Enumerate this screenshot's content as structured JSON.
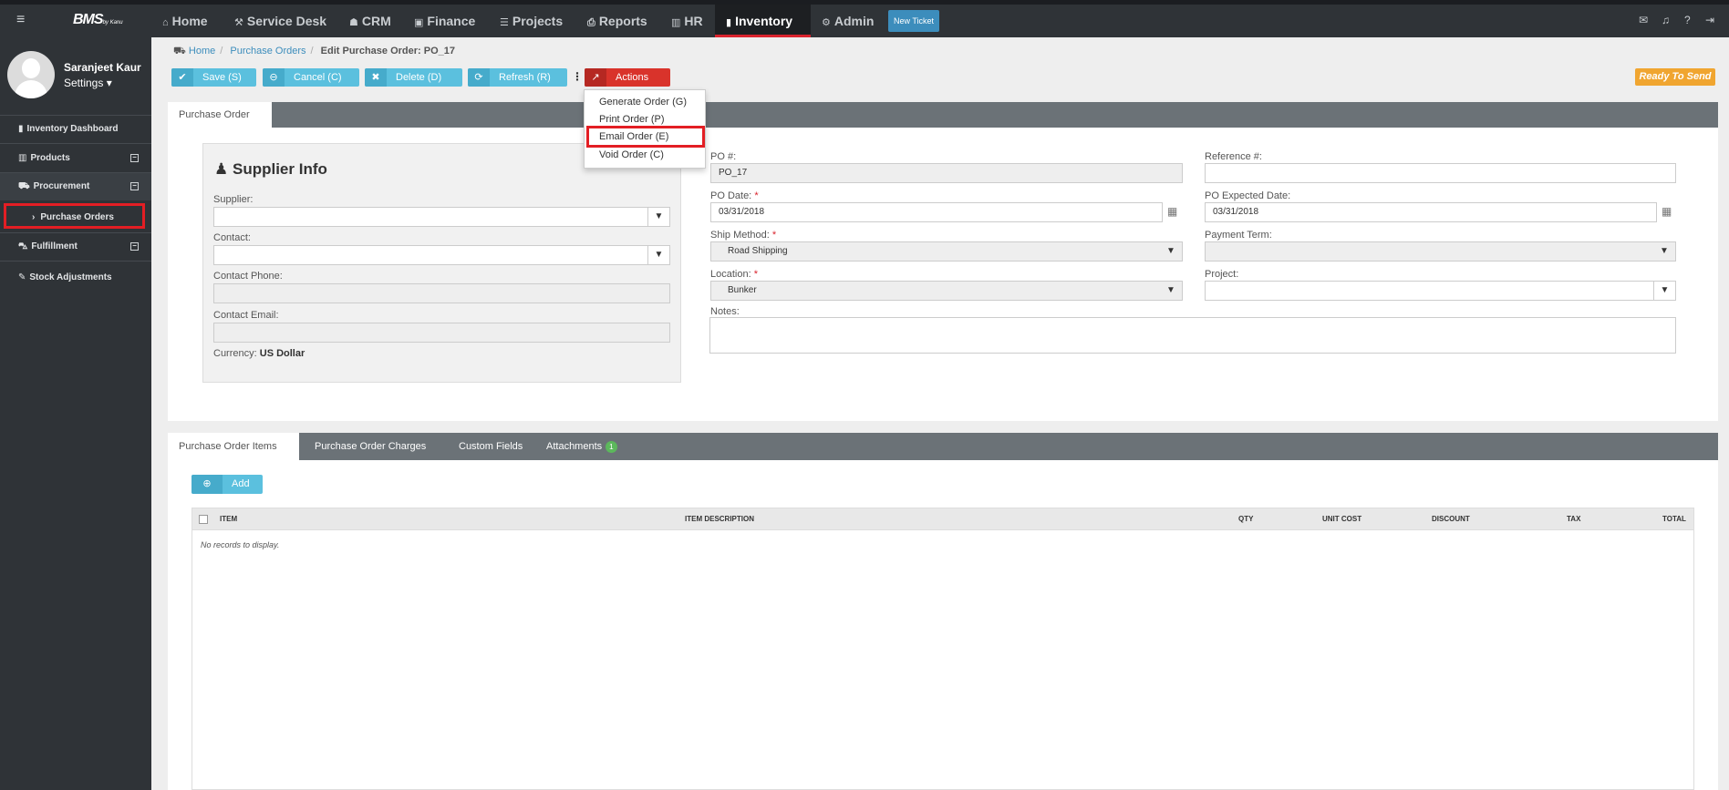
{
  "topbar": {
    "logo": "BMS",
    "logo_sub": "by Kanu",
    "nav": [
      {
        "icon": "home-icon",
        "glyph": "⌂",
        "label": "Home"
      },
      {
        "icon": "service-desk-icon",
        "glyph": "⚒",
        "label": "Service Desk"
      },
      {
        "icon": "crm-icon",
        "glyph": "☗",
        "label": "CRM"
      },
      {
        "icon": "finance-icon",
        "glyph": "▣",
        "label": "Finance"
      },
      {
        "icon": "projects-icon",
        "glyph": "☰",
        "label": "Projects"
      },
      {
        "icon": "reports-icon",
        "glyph": "⎙",
        "label": "Reports"
      },
      {
        "icon": "hr-icon",
        "glyph": "▥",
        "label": "HR"
      },
      {
        "icon": "inventory-icon",
        "glyph": "▮",
        "label": "Inventory"
      },
      {
        "icon": "admin-icon",
        "glyph": "⚙",
        "label": "Admin"
      }
    ],
    "new_ticket": "New Ticket",
    "icons": [
      "mail-icon",
      "bell-icon",
      "help-icon",
      "logout-icon"
    ]
  },
  "sidebar": {
    "user_name": "Saranjeet Kaur",
    "settings": "Settings ▾",
    "items": [
      {
        "label": "Inventory Dashboard",
        "icon": "dashboard-icon"
      },
      {
        "label": "Products",
        "icon": "products-icon"
      },
      {
        "label": "Procurement",
        "icon": "truck-icon"
      },
      {
        "label": "Purchase Orders",
        "icon": "chevron-right-icon"
      },
      {
        "label": "Fulfillment",
        "icon": "cart-icon"
      },
      {
        "label": "Stock Adjustments",
        "icon": "wrench-icon"
      }
    ]
  },
  "breadcrumb": {
    "home": "Home",
    "purchase_orders": "Purchase Orders",
    "current": "Edit Purchase Order: PO_17"
  },
  "toolbar": {
    "save": "Save (S)",
    "cancel": "Cancel (C)",
    "delete": "Delete (D)",
    "refresh": "Refresh (R)",
    "actions": "Actions",
    "status": "Ready To Send"
  },
  "actions_menu": {
    "items": [
      "Generate Order (G)",
      "Print Order (P)",
      "Email Order (E)",
      "Void Order (C)"
    ]
  },
  "top_tab": "Purchase Order",
  "supplier_info": {
    "title": "Supplier Info",
    "supplier_label": "Supplier:",
    "supplier_value": "",
    "contact_label": "Contact:",
    "contact_value": "",
    "phone_label": "Contact Phone:",
    "phone_value": "",
    "email_label": "Contact Email:",
    "email_value": "",
    "currency_label": "Currency:",
    "currency_value": "US Dollar"
  },
  "form": {
    "po_number_label": "PO #:",
    "po_number": "PO_17",
    "reference_label": "Reference #:",
    "reference": "",
    "po_date_label": "PO Date:",
    "po_date": "03/31/2018",
    "expected_date_label": "PO Expected Date:",
    "expected_date": "03/31/2018",
    "ship_method_label": "Ship Method:",
    "ship_method": "Road Shipping",
    "payment_term_label": "Payment Term:",
    "payment_term": "",
    "location_label": "Location:",
    "location": "Bunker",
    "project_label": "Project:",
    "project": "",
    "notes_label": "Notes:",
    "notes": ""
  },
  "bottom_tabs": [
    {
      "label": "Purchase Order Items"
    },
    {
      "label": "Purchase Order Charges"
    },
    {
      "label": "Custom Fields"
    },
    {
      "label": "Attachments",
      "badge": "1"
    }
  ],
  "items_grid": {
    "add_label": "Add",
    "columns": [
      "ITEM",
      "ITEM DESCRIPTION",
      "QTY",
      "UNIT COST",
      "DISCOUNT",
      "TAX",
      "TOTAL"
    ],
    "empty_text": "No records to display."
  }
}
